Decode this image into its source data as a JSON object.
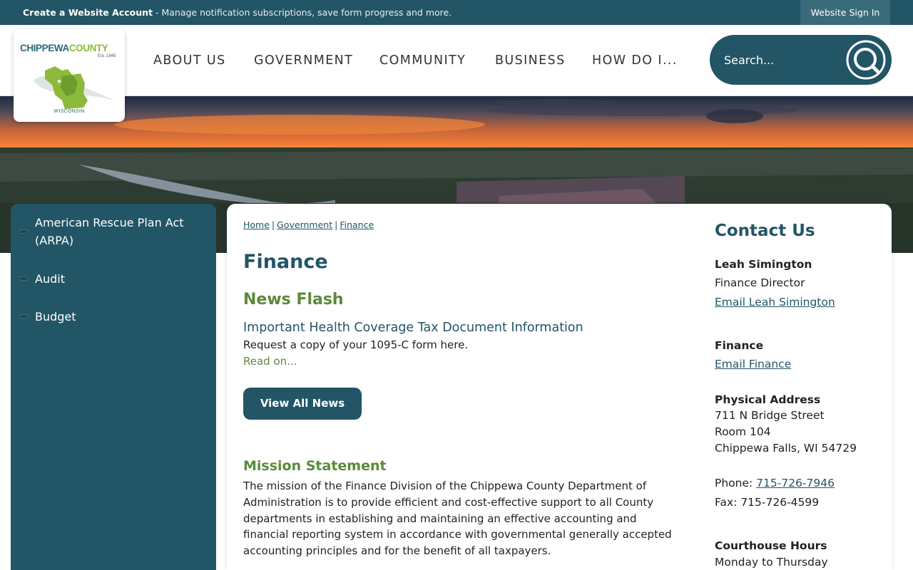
{
  "topbar": {
    "create_label": "Create a Website Account",
    "create_rest": " - Manage notification subscriptions, save form progress and more.",
    "signin_label": "Website Sign In"
  },
  "logo": {
    "name_part1": "CHIPPEWA",
    "name_part2": "COUNTY",
    "established": "Est. 1845",
    "state": "WISCONSIN"
  },
  "nav": {
    "items": [
      "ABOUT US",
      "GOVERNMENT",
      "COMMUNITY",
      "BUSINESS",
      "HOW DO I..."
    ]
  },
  "search": {
    "placeholder": "Search..."
  },
  "sidebar": {
    "items": [
      {
        "label": "American Rescue Plan Act (ARPA)"
      },
      {
        "label": "Audit"
      },
      {
        "label": "Budget"
      }
    ]
  },
  "breadcrumb": {
    "items": [
      "Home",
      "Government",
      "Finance"
    ],
    "separator": "|"
  },
  "main": {
    "title": "Finance",
    "news_flash_title": "News Flash",
    "news_headline": "Important Health Coverage Tax Document Information",
    "news_desc": "Request a copy of your 1095-C form here.",
    "read_on": "Read on...",
    "view_all": "View All News",
    "mission_title": "Mission Statement",
    "mission_text": "The mission of the Finance Division of the Chippewa County Department of Administration is to provide efficient and cost-effective support to all County departments in establishing and maintaining an effective accounting and financial reporting system in accordance with governmental generally accepted accounting principles and for the benefit of all taxpayers."
  },
  "contact": {
    "title": "Contact Us",
    "person_name": "Leah Simington",
    "person_role": "Finance Director",
    "person_email": "Email Leah Simington",
    "dept_name": "Finance",
    "dept_email": "Email Finance",
    "address_label": "Physical Address",
    "address_line1": "711 N Bridge Street",
    "address_line2": "Room 104",
    "address_line3": "Chippewa Falls, WI 54729",
    "phone_label": "Phone: ",
    "phone": "715-726-7946",
    "fax": "Fax: 715-726-4599",
    "hours_label": "Courthouse Hours",
    "hours_days": "Monday to Thursday"
  },
  "colors": {
    "primary": "#225566",
    "accent_green": "#5b8a3a",
    "logo_green": "#8dba3b"
  }
}
